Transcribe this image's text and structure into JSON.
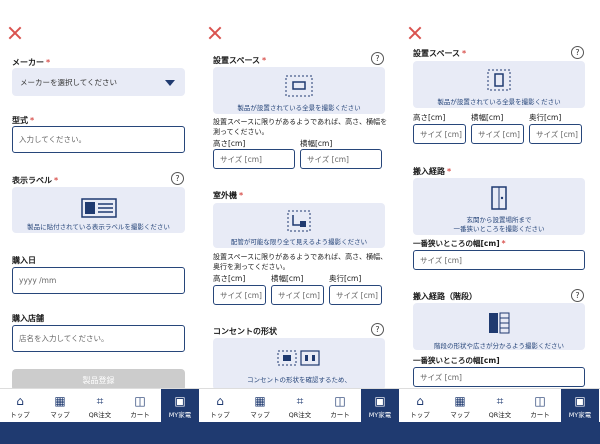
{
  "panel1": {
    "maker_label": "メーカー",
    "maker_select": "メーカーを選択してください",
    "model_label": "型式",
    "model_placeholder": "入力してください。",
    "display_label_title": "表示ラベル",
    "display_label_caption": "製品に貼付されている表示ラベルを撮影ください",
    "purchase_date_label": "購入日",
    "purchase_date_placeholder": "yyyy /mm",
    "store_label": "購入店舗",
    "store_placeholder": "店名を入力してください。",
    "register_button": "製品登録"
  },
  "panel2": {
    "space_label": "設置スペース",
    "space_caption": "製品が設置されている全景を撮影ください",
    "space_note": "設置スペースに限りがあるようであれば、高さ、横幅を測ってください。",
    "height_label": "高さ[cm]",
    "width_label": "横幅[cm]",
    "size_placeholder": "サイズ [cm]",
    "outdoor_label": "室外機",
    "outdoor_caption": "配管が可能な限り全て見えるよう撮影ください",
    "outdoor_note": "設置スペースに限りがあるようであれば、高さ、横幅、奥行を測ってください。",
    "depth_label": "奥行[cm]",
    "outlet_label": "コンセントの形状",
    "outlet_caption": "コンセントの形状を確認するため、"
  },
  "panel3": {
    "space_label": "設置スペース",
    "space_caption": "製品が設置されている全景を撮影ください",
    "height_label": "高さ[cm]",
    "width_label": "横幅[cm]",
    "depth_label": "奥行[cm]",
    "size_placeholder": "サイズ [cm]",
    "route_label": "搬入経路",
    "route_caption_1": "玄関から設置場所まで",
    "route_caption_2": "一番狭いところを撮影ください",
    "narrow_label": "一番狭いところの幅[cm]",
    "stairs_label": "搬入経路（階段）",
    "stairs_caption": "階段の形状や広さが分かるよう撮影ください",
    "narrow2_label": "一番狭いところの幅[cm]"
  },
  "nav": {
    "top": "トップ",
    "map": "マップ",
    "qr": "QR注文",
    "cart": "カート",
    "my": "MY家電"
  },
  "required_mark": "*",
  "help_mark": "?"
}
